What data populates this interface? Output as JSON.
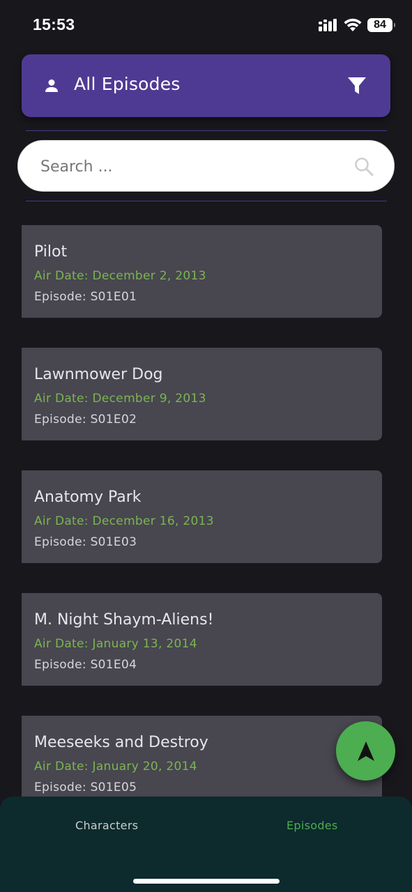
{
  "status_bar": {
    "time": "15:53",
    "battery": "84",
    "icons": [
      "cellular-signal-icon",
      "wifi-icon",
      "battery-icon"
    ]
  },
  "header": {
    "title": "All Episodes",
    "left_icon": "person-icon",
    "right_icon": "filter-icon"
  },
  "search": {
    "placeholder": "Search ...",
    "value": "",
    "icon": "search-icon"
  },
  "episodes": [
    {
      "name": "Pilot",
      "air_date": "Air Date: December 2, 2013",
      "episode": "Episode: S01E01"
    },
    {
      "name": "Lawnmower Dog",
      "air_date": "Air Date: December 9, 2013",
      "episode": "Episode: S01E02"
    },
    {
      "name": "Anatomy Park",
      "air_date": "Air Date: December 16, 2013",
      "episode": "Episode: S01E03"
    },
    {
      "name": "M. Night Shaym-Aliens!",
      "air_date": "Air Date: January 13, 2014",
      "episode": "Episode: S01E04"
    },
    {
      "name": "Meeseeks and Destroy",
      "air_date": "Air Date: January 20, 2014",
      "episode": "Episode: S01E05"
    }
  ],
  "fab": {
    "icon": "navigation-arrow-icon"
  },
  "bottom_nav": {
    "tabs": [
      {
        "label": "Characters",
        "active": false
      },
      {
        "label": "Episodes",
        "active": true
      }
    ]
  },
  "colors": {
    "background": "#18171c",
    "header": "#4f3a93",
    "card": "#48464f",
    "air_date": "#7ab650",
    "accent_green": "#4cae50",
    "bottom_nav": "#0d2a2c"
  }
}
